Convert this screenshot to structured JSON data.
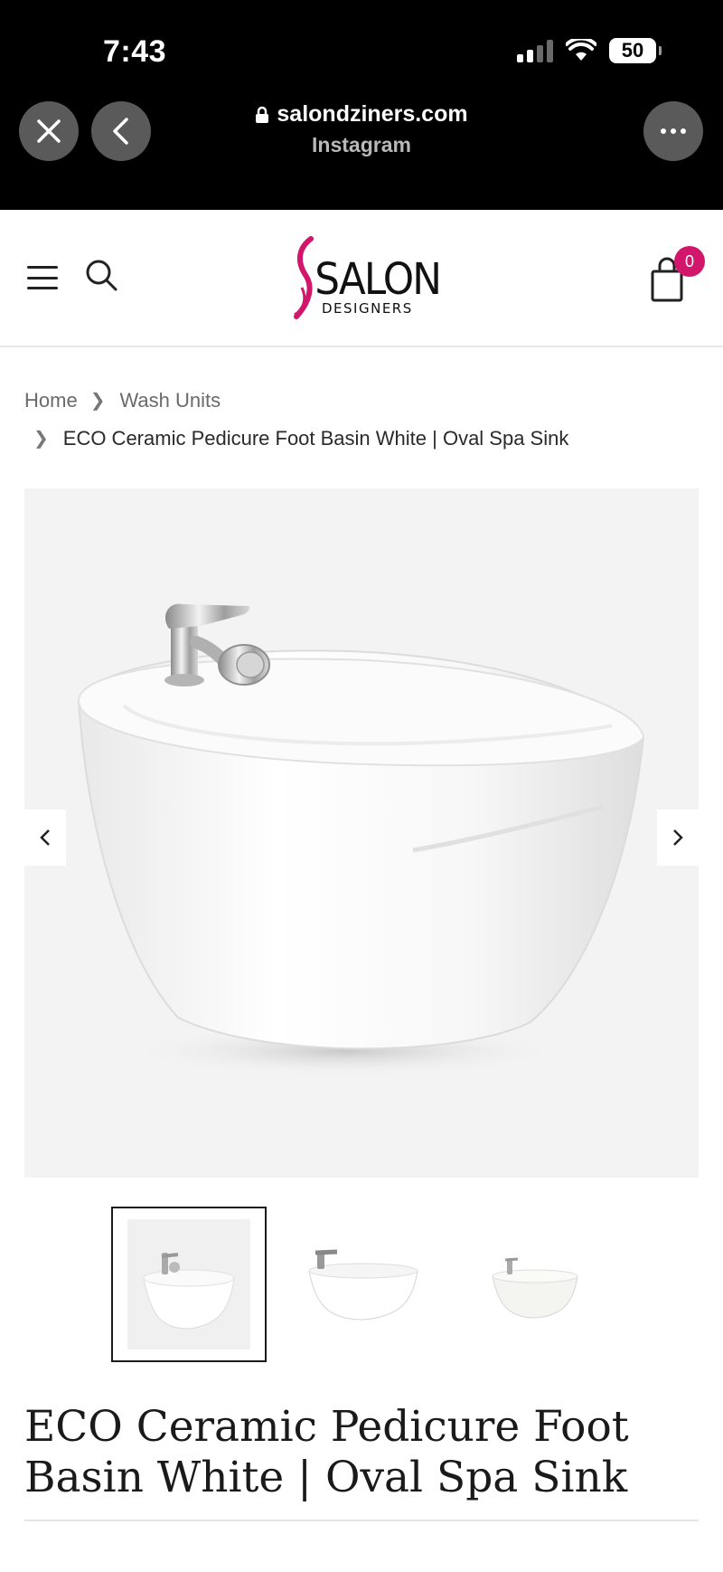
{
  "status_bar": {
    "time": "7:43",
    "battery": "50",
    "icons": [
      "cellular-signal-icon",
      "wifi-icon",
      "battery-icon"
    ]
  },
  "browser": {
    "url": "salondziners.com",
    "source": "Instagram",
    "icons": [
      "close-icon",
      "back-icon",
      "lock-icon",
      "more-icon"
    ]
  },
  "site_header": {
    "logo_text": "SALON",
    "logo_subtext": "DESIGNERS",
    "cart_count": "0",
    "icons": [
      "menu-icon",
      "search-icon",
      "cart-icon"
    ],
    "colors": {
      "accent": "#d1166b"
    }
  },
  "breadcrumb": {
    "items": [
      "Home",
      "Wash Units"
    ],
    "current": "ECO Ceramic Pedicure Foot Basin White | Oval Spa Sink"
  },
  "gallery": {
    "image_alt": "white ceramic oval foot basin with chrome faucet",
    "thumbnail_count": 3,
    "active_thumbnail": 1,
    "icons": [
      "chevron-left-icon",
      "chevron-right-icon"
    ]
  },
  "product": {
    "title": "ECO Ceramic Pedicure Foot Basin White | Oval Spa Sink"
  }
}
